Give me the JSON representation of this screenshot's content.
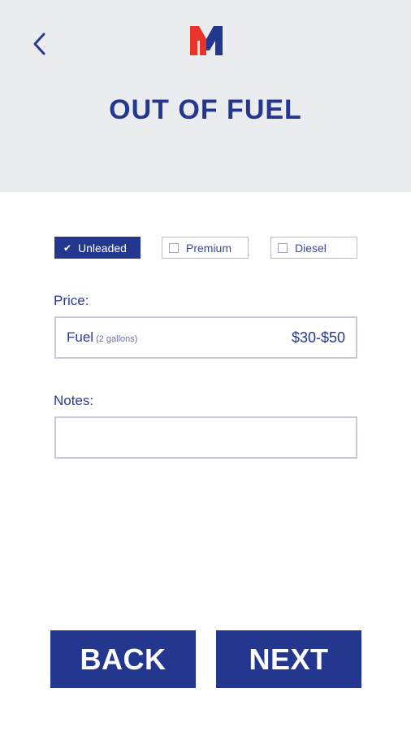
{
  "header": {
    "title": "OUT OF FUEL",
    "back_icon": "chevron-left-icon",
    "logo": {
      "letter": "M",
      "colors": {
        "left": "#e8332a",
        "right": "#24378f"
      }
    }
  },
  "fuel_types": [
    {
      "label": "Unleaded",
      "selected": true
    },
    {
      "label": "Premium",
      "selected": false
    },
    {
      "label": "Diesel",
      "selected": false
    }
  ],
  "price": {
    "label": "Price:",
    "item_name": "Fuel",
    "item_detail": "(2 gallons)",
    "value": "$30-$50"
  },
  "notes": {
    "label": "Notes:",
    "value": ""
  },
  "buttons": {
    "back_label": "BACK",
    "next_label": "NEXT"
  },
  "colors": {
    "brand_blue": "#24378f",
    "header_bg": "#ebecf0",
    "brand_red": "#e8332a"
  }
}
